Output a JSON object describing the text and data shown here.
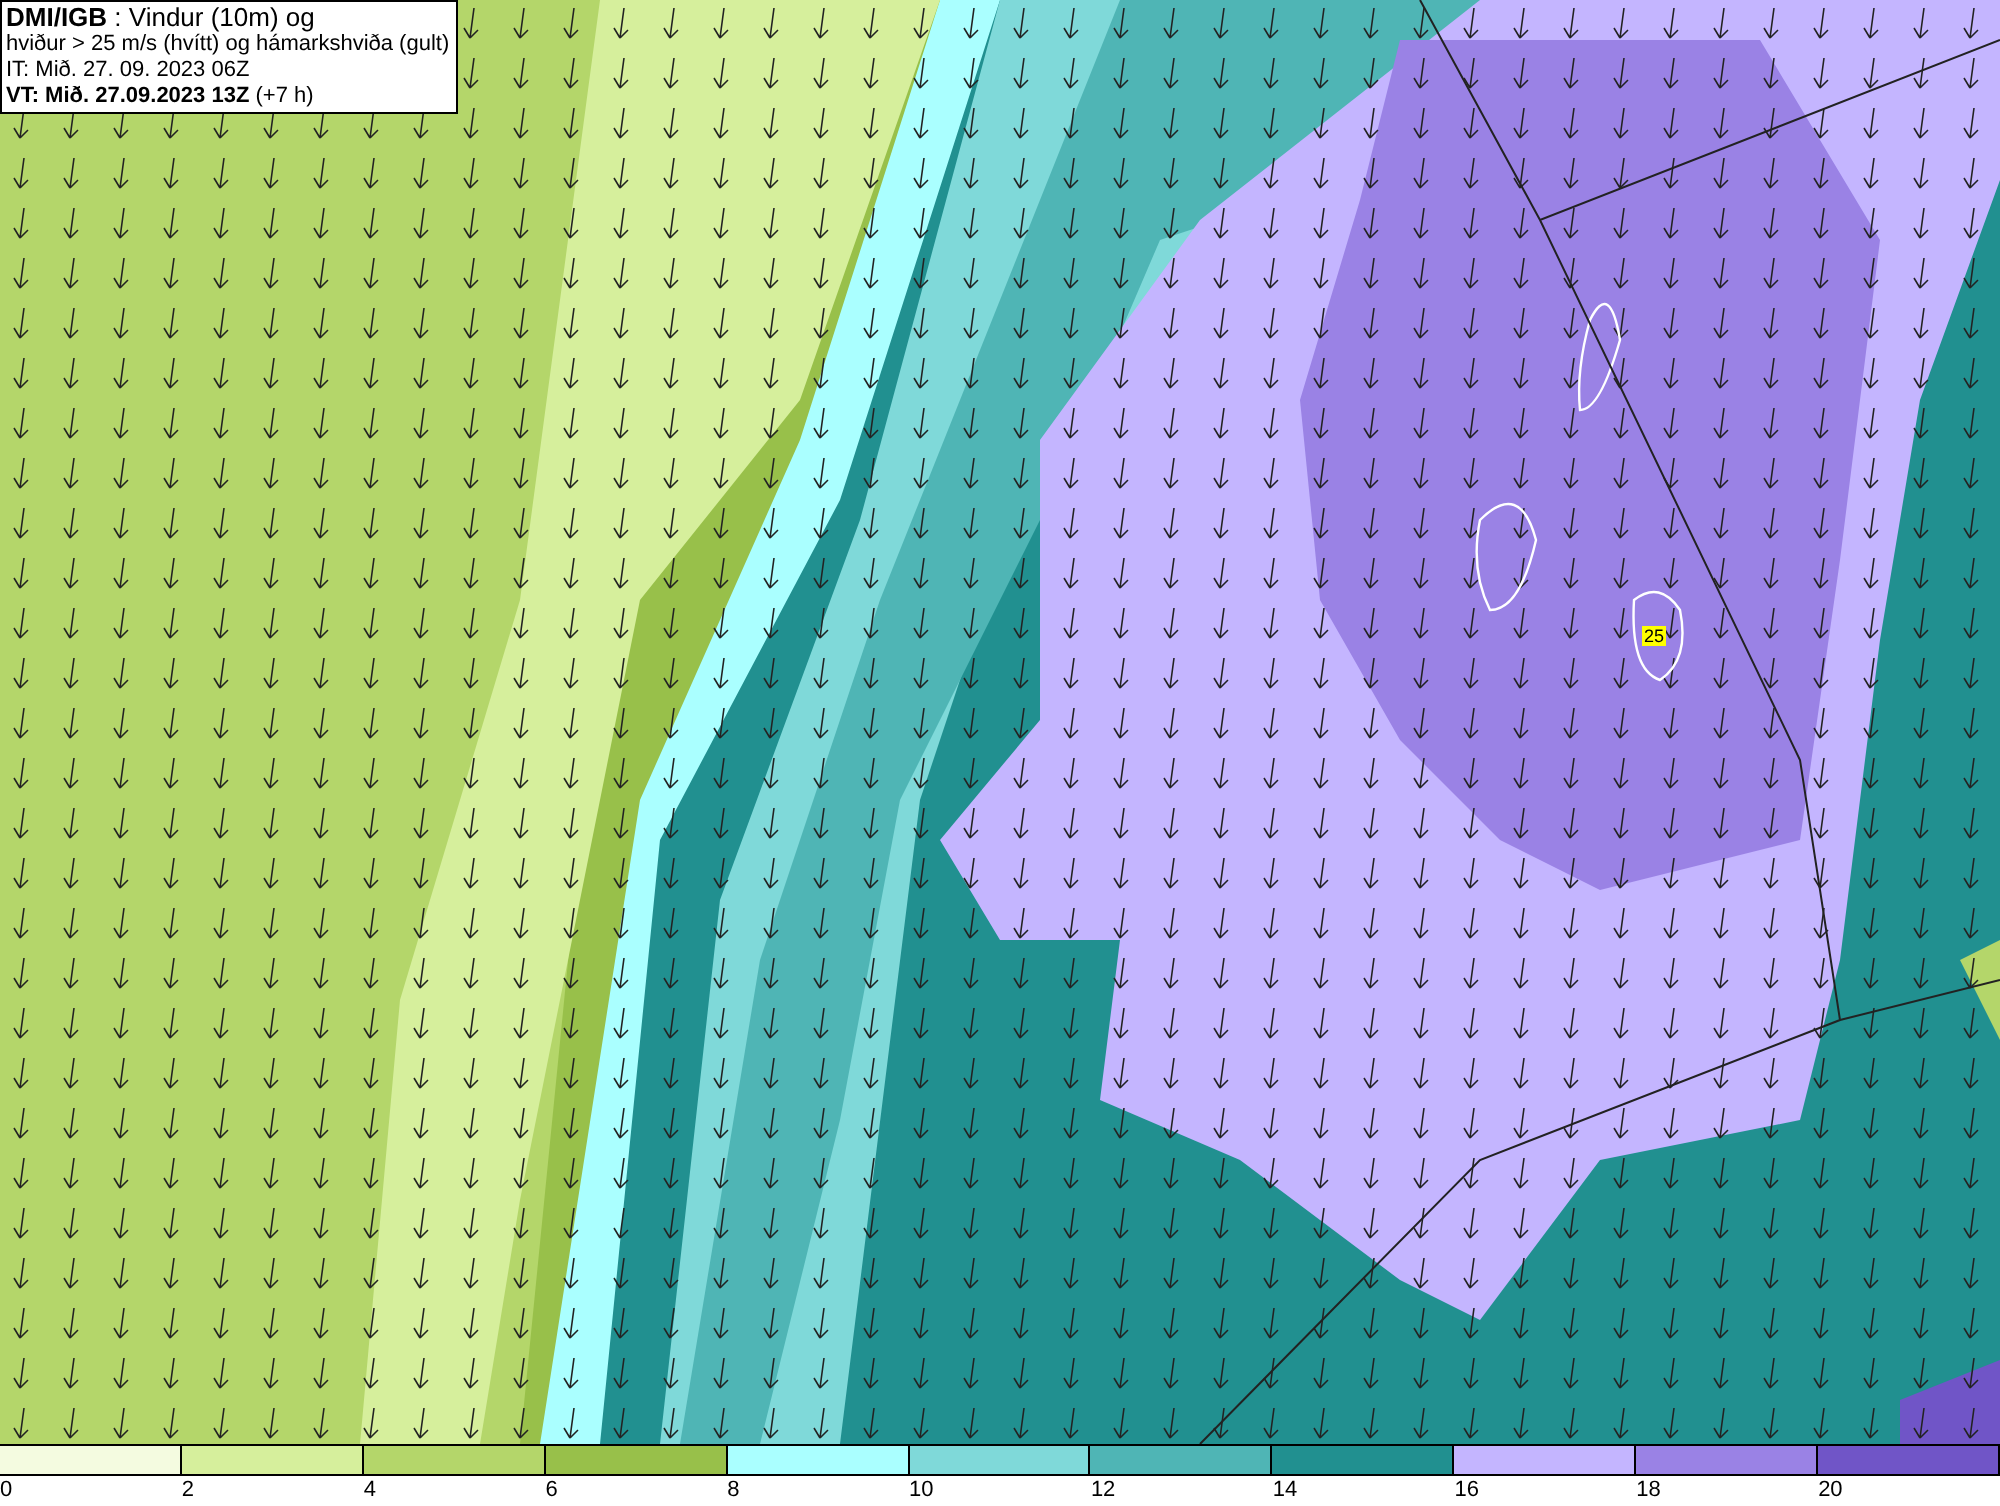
{
  "title_box": {
    "lines": [
      "**DMI/IGB** : Vindur (10m) og",
      "hviður > 25 m/s (hvítt) og hámarkshviða (gult)",
      "IT: Mið. 27. 09. 2023 06Z",
      "**VT: Mið. 27.09.2023 13Z** (+7 h)"
    ]
  },
  "map": {
    "gust_label": "25"
  },
  "legend": {
    "bins": [
      {
        "tick": "0",
        "color": "#f4fbe0"
      },
      {
        "tick": "2",
        "color": "#d6ef9c"
      },
      {
        "tick": "4",
        "color": "#b4d66a"
      },
      {
        "tick": "6",
        "color": "#98c04a"
      },
      {
        "tick": "8",
        "color": "#aaffff"
      },
      {
        "tick": "10",
        "color": "#7fd9d9"
      },
      {
        "tick": "12",
        "color": "#4fb5b5"
      },
      {
        "tick": "14",
        "color": "#219090"
      },
      {
        "tick": "16",
        "color": "#c4b5ff"
      },
      {
        "tick": "18",
        "color": "#9a82e5"
      },
      {
        "tick": "20",
        "color": "#7055c7"
      }
    ]
  }
}
